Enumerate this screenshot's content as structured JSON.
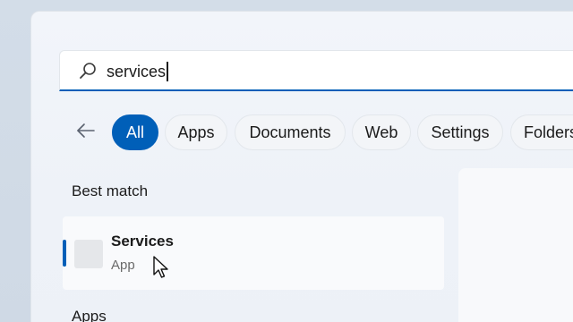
{
  "search": {
    "value": "services",
    "icon": "search-icon"
  },
  "filters": {
    "back_icon": "arrow-left-icon",
    "chips": [
      {
        "label": "All",
        "active": true
      },
      {
        "label": "Apps"
      },
      {
        "label": "Documents"
      },
      {
        "label": "Web"
      },
      {
        "label": "Settings"
      },
      {
        "label": "Folders"
      }
    ]
  },
  "best_match": {
    "heading": "Best match",
    "item": {
      "name": "Services",
      "type": "App",
      "icon": "app-icon"
    }
  },
  "apps_section": {
    "heading": "Apps"
  },
  "colors": {
    "accent": "#005fb8"
  }
}
